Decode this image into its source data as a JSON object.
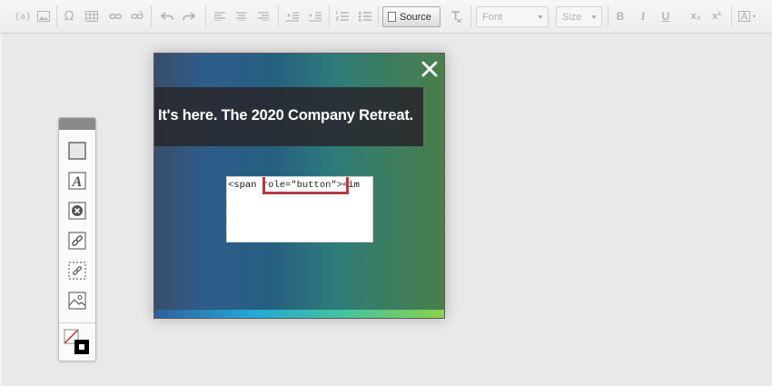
{
  "toolbar": {
    "source_label": "Source",
    "font_select": {
      "value": "Font"
    },
    "size_select": {
      "value": "Size"
    },
    "bold_label": "B",
    "italic_label": "I",
    "underline_label": "U",
    "subscript_label": "x₂",
    "superscript_label": "x²",
    "template_label": "{a}",
    "special_char_label": "Ω",
    "icons": [
      "template-icon",
      "image-icon",
      "special-char-icon",
      "table-icon",
      "link-icon",
      "unlink-icon",
      "undo-icon",
      "redo-icon",
      "align-left-icon",
      "align-center-icon",
      "align-right-icon",
      "outdent-icon",
      "indent-icon",
      "numbered-list-icon",
      "bulleted-list-icon",
      "source-icon",
      "clear-format-icon",
      "text-color-icon"
    ]
  },
  "palette": {
    "tools": [
      "box-tool-icon",
      "text-tool-icon",
      "close-button-tool-icon",
      "link-tool-icon",
      "dashed-link-tool-icon",
      "image-tool-icon",
      "color-swatch-icon"
    ]
  },
  "canvas": {
    "headline": "It's here. The 2020 Company Retreat.",
    "code_text": "<span role=\"button\"><im",
    "highlight_color": "#b23a48"
  }
}
